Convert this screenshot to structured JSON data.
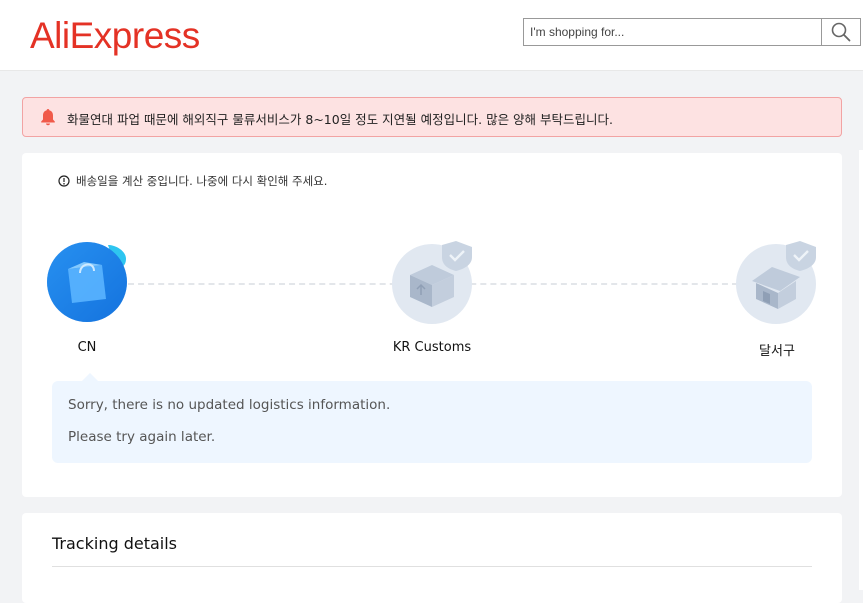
{
  "header": {
    "logo_text": "AliExpress",
    "search_placeholder": "I'm shopping for...",
    "search_icon": "search-icon"
  },
  "notice": {
    "icon": "bell-icon",
    "text": "화물연대 파업 때문에 해외직구 물류서비스가 8~10일 정도 지연될 예정입니다. 많은 양해 부탁드립니다."
  },
  "delivery": {
    "eta_icon": "info-icon",
    "eta_text": "배송일을 계산 중입니다. 나중에 다시 확인해 주세요.",
    "nodes": [
      {
        "label": "CN",
        "icon": "shopping-bag-icon",
        "state": "active"
      },
      {
        "label": "KR Customs",
        "icon": "customs-package-icon",
        "state": "pending"
      },
      {
        "label": "달서구",
        "icon": "house-icon",
        "state": "pending"
      }
    ],
    "info_lines": [
      "Sorry, there is no updated logistics information.",
      "Please try again later."
    ]
  },
  "tracking": {
    "title": "Tracking details"
  },
  "colors": {
    "brand": "#e43225",
    "active_node": "#1a7fe8",
    "notice_bg": "#fde2e2",
    "info_bg": "#eef6ff"
  }
}
